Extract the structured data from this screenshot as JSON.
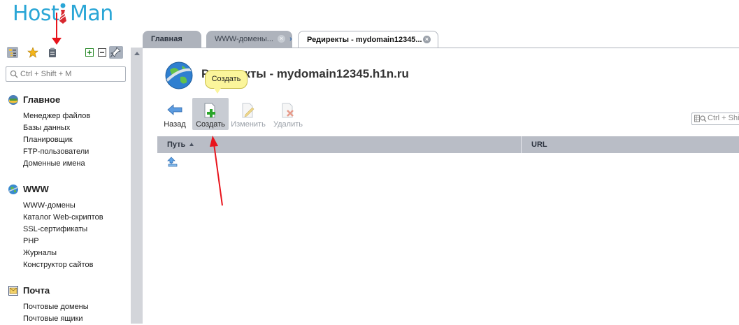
{
  "logo": {
    "part1": "Host",
    "part2": "Man"
  },
  "sidebar": {
    "search_placeholder": "Ctrl + Shift + M",
    "sections": [
      {
        "title": "Главное",
        "items": [
          "Менеджер файлов",
          "Базы данных",
          "Планировщик",
          "FTP-пользователи",
          "Доменные имена"
        ]
      },
      {
        "title": "WWW",
        "items": [
          "WWW-домены",
          "Каталог Web-скриптов",
          "SSL-сертификаты",
          "PHP",
          "Журналы",
          "Конструктор сайтов"
        ]
      },
      {
        "title": "Почта",
        "items": [
          "Почтовые домены",
          "Почтовые ящики"
        ]
      }
    ]
  },
  "tabs": [
    {
      "label": "Главная"
    },
    {
      "label": "WWW-домены..."
    },
    {
      "label": "Редиректы - mydomain12345..."
    }
  ],
  "page": {
    "title": "Редиректы - mydomain12345.h1n.ru"
  },
  "toolbar": {
    "back": "Назад",
    "create": "Создать",
    "edit": "Изменить",
    "delete": "Удалить",
    "tooltip": "Создать",
    "search_placeholder": "Ctrl + Shi"
  },
  "table": {
    "columns": [
      "Путь",
      "URL"
    ]
  },
  "colors": {
    "accent": "#2aa6d6",
    "annotation": "#e8141c",
    "tooltip": "#fbf59b"
  }
}
